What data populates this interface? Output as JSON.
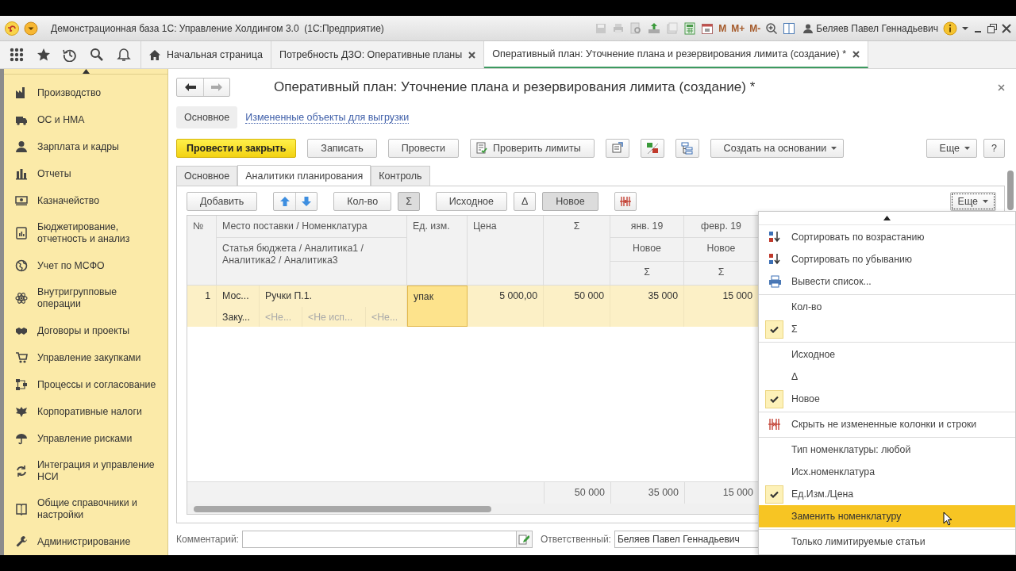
{
  "window": {
    "title": "Демонстрационная база 1С: Управление Холдингом 3.0  (1С:Предприятие)",
    "memory_buttons": [
      "M",
      "M+",
      "M-"
    ],
    "user": "Беляев Павел Геннадьевич"
  },
  "tabs": [
    {
      "kind": "home",
      "label": "Начальная страница",
      "selected": false,
      "closable": false
    },
    {
      "kind": "document",
      "label": "Потребность ДЗО: Оперативные планы",
      "selected": false,
      "closable": true
    },
    {
      "kind": "document",
      "label": "Оперативный план: Уточнение плана и резервирования лимита (создание) *",
      "selected": true,
      "closable": true
    }
  ],
  "sidebar": {
    "items": [
      {
        "label": "Производство"
      },
      {
        "label": "ОС и НМА"
      },
      {
        "label": "Зарплата и кадры"
      },
      {
        "label": "Отчеты"
      },
      {
        "label": "Казначейство"
      },
      {
        "label": "Бюджетирование, отчетность и анализ"
      },
      {
        "label": "Учет по МСФО"
      },
      {
        "label": "Внутригрупповые операции"
      },
      {
        "label": "Договоры и проекты"
      },
      {
        "label": "Управление закупками"
      },
      {
        "label": "Процессы и согласование"
      },
      {
        "label": "Корпоративные налоги"
      },
      {
        "label": "Управление рисками"
      },
      {
        "label": "Интеграция и управление НСИ"
      },
      {
        "label": "Общие справочники и настройки"
      },
      {
        "label": "Администрирование"
      }
    ]
  },
  "form": {
    "title": "Оперативный план: Уточнение плана и резервирования лимита (создание) *",
    "sections": [
      {
        "kind": "pill",
        "label": "Основное",
        "selected": true
      },
      {
        "kind": "link",
        "label": "Измененные объекты для выгрузки",
        "selected": false
      }
    ],
    "commands": [
      {
        "kind": "primary",
        "label": "Провести и закрыть"
      },
      {
        "kind": "plain",
        "label": "Записать"
      },
      {
        "kind": "plain",
        "label": "Провести"
      },
      {
        "kind": "check",
        "label": "Проверить лимиты"
      },
      {
        "kind": "memo"
      },
      {
        "kind": "ledger"
      },
      {
        "kind": "tree"
      },
      {
        "kind": "dropdown",
        "label": "Создать на основании"
      }
    ],
    "commands_right": [
      {
        "kind": "dropdown",
        "label": "Еще"
      },
      {
        "kind": "plain",
        "label": "?"
      }
    ],
    "panel_tabs": [
      {
        "label": "Основное",
        "selected": false
      },
      {
        "label": "Аналитики планирования",
        "selected": true
      },
      {
        "label": "Контроль",
        "selected": false
      }
    ],
    "table_toolbar": [
      [
        {
          "kind": "plain",
          "label": "Добавить"
        }
      ],
      [
        {
          "kind": "up"
        },
        {
          "kind": "down"
        }
      ],
      [
        {
          "kind": "toggle",
          "label": "Кол-во",
          "pressed": false
        },
        {
          "kind": "toggle",
          "label": "Σ",
          "pressed": true
        }
      ],
      [
        {
          "kind": "toggle",
          "label": "Исходное",
          "pressed": false
        },
        {
          "kind": "toggle",
          "label": "Δ",
          "pressed": false
        },
        {
          "kind": "toggle",
          "label": "Новое",
          "pressed": true
        }
      ],
      [
        {
          "kind": "hide"
        }
      ]
    ],
    "table_more": {
      "label": "Еще",
      "focused": true
    },
    "table": {
      "header": {
        "number": "№",
        "place_nomenclature": "Место поставки / Номенклатура",
        "budget_item": "Статья бюджета / Аналитика1 / Аналитика2 / Аналитика3",
        "unit": "Ед. изм.",
        "price": "Цена",
        "sum": "Σ",
        "periods": [
          {
            "label": "янв. 19",
            "version": "Новое",
            "measure": "Σ"
          },
          {
            "label": "февр. 19",
            "version": "Новое",
            "measure": "Σ"
          }
        ]
      },
      "rows": [
        {
          "number": "1",
          "place": "Мос...",
          "nomenclature": "Ручки П.1.",
          "budget_item": "Заку...",
          "analytics": [
            "<Не...",
            "<Не исп...",
            "<Не..."
          ],
          "unit": "упак",
          "unit_focused": true,
          "price": "5 000,00",
          "sum": "50 000",
          "periods": [
            "35 000",
            "15 000"
          ],
          "selected": true
        }
      ],
      "totals": {
        "sum": "50 000",
        "periods": [
          "35 000",
          "15 000"
        ]
      }
    },
    "comment_label": "Комментарий:",
    "responsible_label": "Ответственный:",
    "responsible": "Беляев Павел Геннадьевич"
  },
  "menu": {
    "groups": [
      [
        {
          "kind": "sortasc",
          "label": "Сортировать по возрастанию",
          "selected": false
        },
        {
          "kind": "sortdesc",
          "label": "Сортировать по убыванию",
          "selected": false
        },
        {
          "kind": "output",
          "label": "Вывести список...",
          "selected": false
        }
      ],
      [
        {
          "kind": "toggle",
          "label": "Кол-во",
          "checked": false,
          "selected": false
        },
        {
          "kind": "toggle",
          "label": "Σ",
          "checked": true,
          "selected": false
        }
      ],
      [
        {
          "kind": "toggle",
          "label": "Исходное",
          "checked": false,
          "selected": false
        },
        {
          "kind": "toggle",
          "label": "Δ",
          "checked": false,
          "selected": false
        },
        {
          "kind": "toggle",
          "label": "Новое",
          "checked": true,
          "selected": false
        }
      ],
      [
        {
          "kind": "hide",
          "label": "Скрыть не измененные колонки и строки",
          "selected": false
        }
      ],
      [
        {
          "kind": "plain",
          "label": "Тип номенклатуры: любой",
          "selected": false
        },
        {
          "kind": "toggle",
          "label": "Исх.номенклатура",
          "checked": false,
          "selected": false
        },
        {
          "kind": "toggle",
          "label": "Ед.Изм./Цена",
          "checked": true,
          "selected": false
        },
        {
          "kind": "plain",
          "label": "Заменить номенклатуру",
          "selected": true
        }
      ],
      [
        {
          "kind": "plain",
          "label": "Только лимитируемые статьи",
          "selected": false
        }
      ]
    ]
  }
}
